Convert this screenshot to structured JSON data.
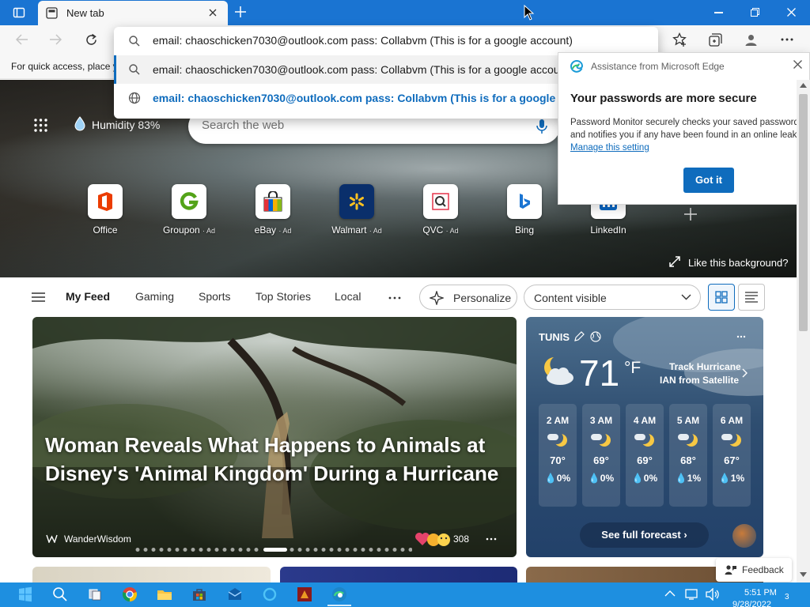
{
  "browser": {
    "tab_title": "New tab",
    "address_value": "email: chaoschicken7030@outlook.com pass: Collabvm (This is for a google account)",
    "suggestions": [
      "email: chaoschicken7030@outlook.com pass: Collabvm (This is for a google account)",
      "email: chaoschicken7030@outlook.com pass: Collabvm (This is for a google acco"
    ],
    "fav_hint": "For quick access, place y"
  },
  "popup": {
    "source": "Assistance from Microsoft Edge",
    "title": "Your passwords are more secure",
    "body": "Password Monitor securely checks your saved passwords and notifies you if any have been found in an online leak.",
    "link": "Manage this setting",
    "button": "Got it"
  },
  "hero": {
    "humidity": "Humidity 83%",
    "search_placeholder": "Search the web",
    "like_bg": "Like this background?",
    "tiles": [
      {
        "name": "Office",
        "ad": ""
      },
      {
        "name": "Groupon",
        "ad": "· Ad"
      },
      {
        "name": "eBay",
        "ad": "· Ad"
      },
      {
        "name": "Walmart",
        "ad": "· Ad"
      },
      {
        "name": "QVC",
        "ad": "· Ad"
      },
      {
        "name": "Bing",
        "ad": ""
      },
      {
        "name": "LinkedIn",
        "ad": ""
      }
    ]
  },
  "feed": {
    "tabs": [
      "My Feed",
      "Gaming",
      "Sports",
      "Top Stories",
      "Local"
    ],
    "personalize": "Personalize",
    "content_visible": "Content visible",
    "main_headline": "Woman Reveals What Happens to Animals at Disney's 'Animal Kingdom' During a Hurricane",
    "source": "WanderWisdom",
    "reactions": "308"
  },
  "weather": {
    "city": "TUNIS",
    "temp": "71",
    "unit": "°F",
    "track_line1": "Track Hurricane",
    "track_line2": "IAN from Satellite",
    "hours": [
      {
        "time": "2 AM",
        "temp": "70°",
        "precip": "0%"
      },
      {
        "time": "3 AM",
        "temp": "69°",
        "precip": "0%"
      },
      {
        "time": "4 AM",
        "temp": "69°",
        "precip": "0%"
      },
      {
        "time": "5 AM",
        "temp": "68°",
        "precip": "1%"
      },
      {
        "time": "6 AM",
        "temp": "67°",
        "precip": "1%"
      }
    ],
    "forecast_btn": "See full forecast"
  },
  "feedback": "Feedback",
  "taskbar": {
    "time": "5:51 PM",
    "date": "9/28/2022",
    "badge": "3"
  },
  "colors": {
    "titlebar": "#1a74d2",
    "accent": "#0f6cbd",
    "taskbar": "#1e8fe0"
  }
}
